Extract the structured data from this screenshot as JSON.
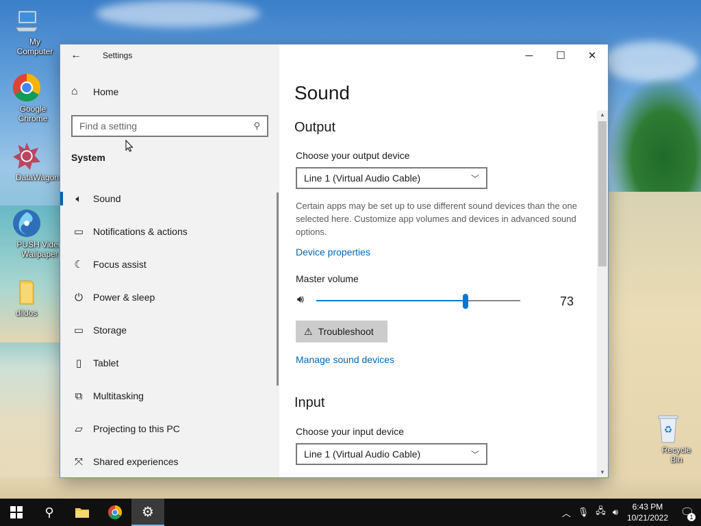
{
  "desktop": {
    "icons": [
      {
        "label": "My Computer"
      },
      {
        "label": "Google Chrome"
      },
      {
        "label": "DataWagon..."
      },
      {
        "label": "PUSH Video Wallpaper"
      },
      {
        "label": "dildos"
      },
      {
        "label": "Recycle Bin"
      }
    ]
  },
  "window": {
    "title": "Settings",
    "controls": {
      "minimize": "─",
      "maximize": "☐",
      "close": "✕"
    }
  },
  "sidebar": {
    "home_label": "Home",
    "search_placeholder": "Find a setting",
    "section_title": "System",
    "items": [
      {
        "label": "Sound",
        "icon": "speaker-icon",
        "active": true
      },
      {
        "label": "Notifications & actions",
        "icon": "notification-icon"
      },
      {
        "label": "Focus assist",
        "icon": "moon-icon"
      },
      {
        "label": "Power & sleep",
        "icon": "power-icon"
      },
      {
        "label": "Storage",
        "icon": "storage-icon"
      },
      {
        "label": "Tablet",
        "icon": "tablet-icon"
      },
      {
        "label": "Multitasking",
        "icon": "multitasking-icon"
      },
      {
        "label": "Projecting to this PC",
        "icon": "projecting-icon"
      },
      {
        "label": "Shared experiences",
        "icon": "shared-icon"
      }
    ]
  },
  "main": {
    "page_title": "Sound",
    "output": {
      "heading": "Output",
      "device_label": "Choose your output device",
      "device_value": "Line 1 (Virtual Audio Cable)",
      "description": "Certain apps may be set up to use different sound devices than the one selected here. Customize app volumes and devices in advanced sound options.",
      "device_properties_link": "Device properties",
      "master_volume_label": "Master volume",
      "master_volume": 73,
      "troubleshoot_label": "Troubleshoot",
      "manage_link": "Manage sound devices"
    },
    "input": {
      "heading": "Input",
      "device_label": "Choose your input device",
      "device_value": "Line 1 (Virtual Audio Cable)"
    }
  },
  "taskbar": {
    "time": "6:43 PM",
    "date": "10/21/2022",
    "notification_count": "1"
  },
  "colors": {
    "accent": "#0078d7",
    "link": "#0067b8",
    "taskbar": "#101010",
    "sidebar_bg": "#f2f2f2"
  }
}
